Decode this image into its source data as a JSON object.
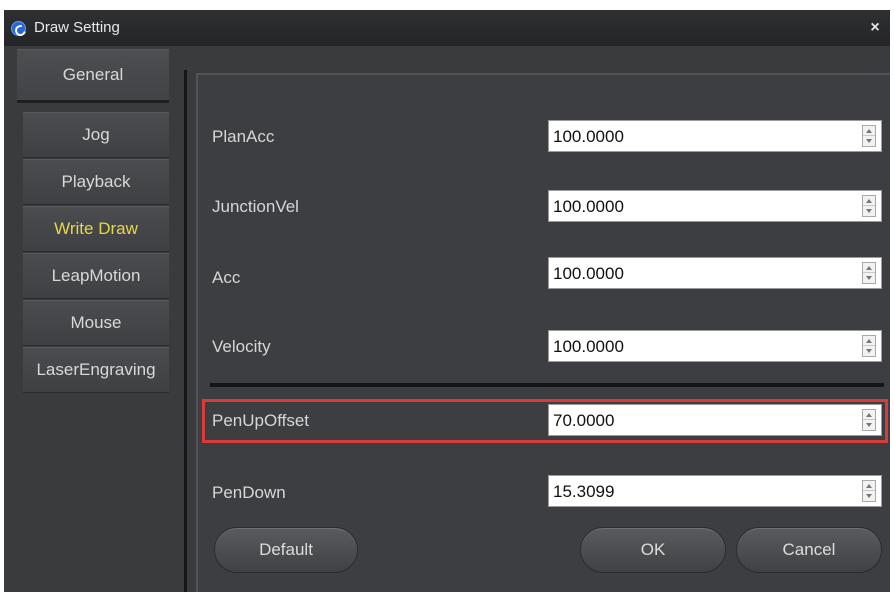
{
  "window": {
    "title": "Draw Setting",
    "close_symbol": "×"
  },
  "nav": {
    "items": [
      {
        "label": "General"
      },
      {
        "label": "Jog"
      },
      {
        "label": "Playback"
      },
      {
        "label": "Write  Draw"
      },
      {
        "label": "LeapMotion"
      },
      {
        "label": "Mouse"
      },
      {
        "label": "LaserEngraving"
      }
    ],
    "selected_index": 3
  },
  "fields": [
    {
      "label": "PlanAcc",
      "value": "100.0000"
    },
    {
      "label": "JunctionVel",
      "value": "100.0000"
    },
    {
      "label": "Acc",
      "value": "100.0000"
    },
    {
      "label": "Velocity",
      "value": "100.0000"
    },
    {
      "label": "PenUpOffset",
      "value": "70.0000"
    },
    {
      "label": "PenDown",
      "value": "15.3099"
    }
  ],
  "buttons": {
    "default_label": "Default",
    "ok_label": "OK",
    "cancel_label": "Cancel"
  },
  "colors": {
    "selected_nav_text": "#e6d74a",
    "highlight_border": "#d93a3a",
    "background": "#3a3b3d"
  }
}
